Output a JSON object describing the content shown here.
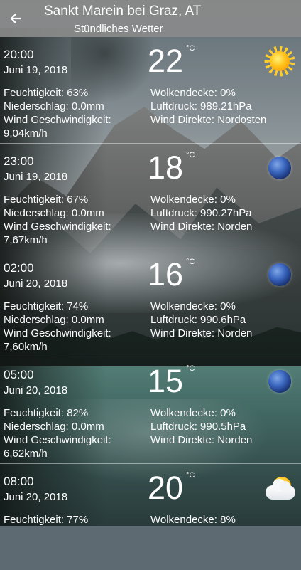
{
  "header": {
    "title": "Sankt Marein bei Graz, AT",
    "subtitle": "Stündliches Wetter"
  },
  "forecast": [
    {
      "time": "20:00",
      "date": "Juni 19, 2018",
      "temp": "22",
      "unit": "°C",
      "icon": "sun-icon",
      "humidity": "Feuchtigkeit: 63%",
      "precipitation": "Niederschlag: 0.0mm",
      "wind_speed": "Wind Geschwindigkeit: 9,04km/h",
      "cloud_cover": "Wolkendecke: 0%",
      "pressure": "Luftdruck: 989.21hPa",
      "wind_direction": "Wind Direkte: Nordosten"
    },
    {
      "time": "23:00",
      "date": "Juni 19, 2018",
      "temp": "18",
      "unit": "°C",
      "icon": "moon-icon",
      "humidity": "Feuchtigkeit: 67%",
      "precipitation": "Niederschlag: 0.0mm",
      "wind_speed": "Wind Geschwindigkeit: 7,67km/h",
      "cloud_cover": "Wolkendecke: 0%",
      "pressure": "Luftdruck: 990.27hPa",
      "wind_direction": "Wind Direkte: Norden"
    },
    {
      "time": "02:00",
      "date": "Juni 20, 2018",
      "temp": "16",
      "unit": "°C",
      "icon": "moon-icon",
      "humidity": "Feuchtigkeit: 74%",
      "precipitation": "Niederschlag: 0.0mm",
      "wind_speed": "Wind Geschwindigkeit: 7,60km/h",
      "cloud_cover": "Wolkendecke: 0%",
      "pressure": "Luftdruck: 990.6hPa",
      "wind_direction": "Wind Direkte: Norden"
    },
    {
      "time": "05:00",
      "date": "Juni 20, 2018",
      "temp": "15",
      "unit": "°C",
      "icon": "moon-icon",
      "humidity": "Feuchtigkeit: 82%",
      "precipitation": "Niederschlag: 0.0mm",
      "wind_speed": "Wind Geschwindigkeit: 6,62km/h",
      "cloud_cover": "Wolkendecke: 0%",
      "pressure": "Luftdruck: 990.5hPa",
      "wind_direction": "Wind Direkte: Norden"
    },
    {
      "time": "08:00",
      "date": "Juni 20, 2018",
      "temp": "20",
      "unit": "°C",
      "icon": "partly-cloudy-icon",
      "humidity": "Feuchtigkeit: 77%",
      "cloud_cover": "Wolkendecke: 8%"
    }
  ]
}
